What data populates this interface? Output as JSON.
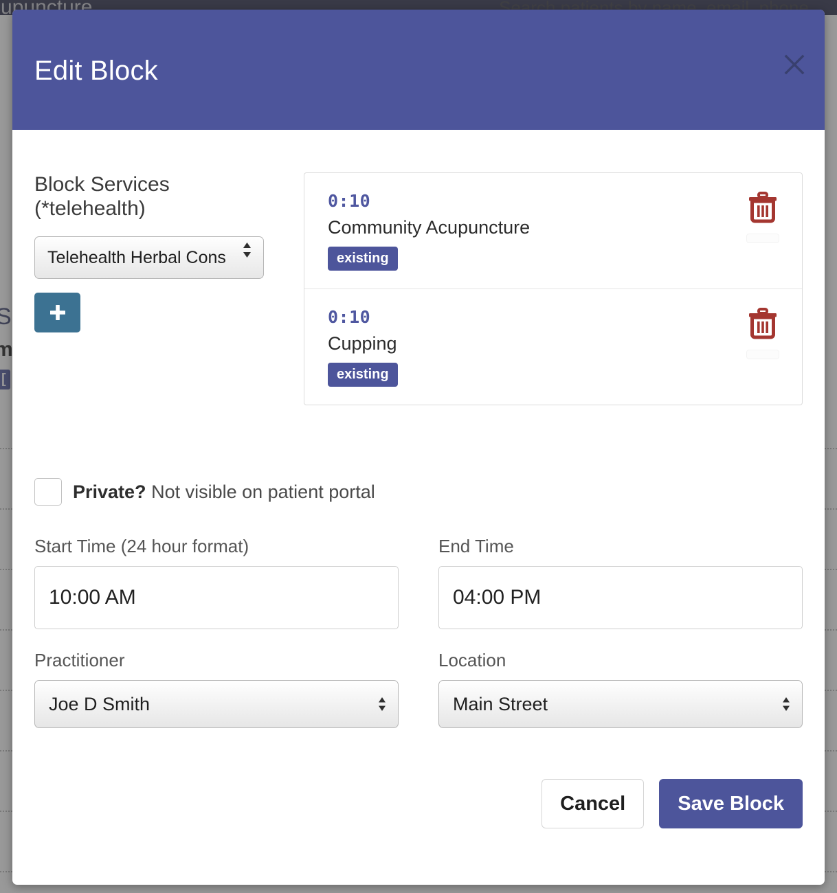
{
  "background": {
    "topbar_title_fragment": "Acupuncture",
    "search_placeholder_fragment": "Search patients by name, email, phone",
    "fragments": [
      {
        "text": "S",
        "style": "normal"
      },
      {
        "text": "m",
        "style": "dark"
      }
    ],
    "chip_label": "["
  },
  "modal": {
    "title": "Edit Block",
    "close_icon": "close-icon",
    "services": {
      "label": "Block Services (*telehealth)",
      "label_line1": "Block Services",
      "label_line2": "(*telehealth)",
      "selected_service": "Telehealth Herbal Cons",
      "service_options": [
        "Telehealth Herbal Cons"
      ],
      "add_icon": "plus-icon",
      "add_label": "+",
      "items": [
        {
          "duration": "0:10",
          "name": "Community Acupuncture",
          "badge": "existing",
          "delete_icon": "trash-icon"
        },
        {
          "duration": "0:10",
          "name": "Cupping",
          "badge": "existing",
          "delete_icon": "trash-icon"
        }
      ]
    },
    "private": {
      "checked": false,
      "label_bold": "Private?",
      "label_rest": " Not visible on patient portal"
    },
    "fields": {
      "start_time_label": "Start Time (24 hour format)",
      "start_time_value": "10:00 AM",
      "end_time_label": "End Time",
      "end_time_value": "04:00 PM",
      "practitioner_label": "Practitioner",
      "practitioner_value": "Joe D Smith",
      "practitioner_options": [
        "Joe D Smith"
      ],
      "location_label": "Location",
      "location_value": "Main Street",
      "location_options": [
        "Main Street"
      ]
    },
    "footer": {
      "cancel_label": "Cancel",
      "save_label": "Save Block"
    }
  },
  "colors": {
    "header_purple": "#4d559b",
    "badge_purple": "#4d559b",
    "add_button_teal": "#3c7292",
    "trash_red": "#a43630",
    "topbar_navy": "#2b2d4a"
  }
}
